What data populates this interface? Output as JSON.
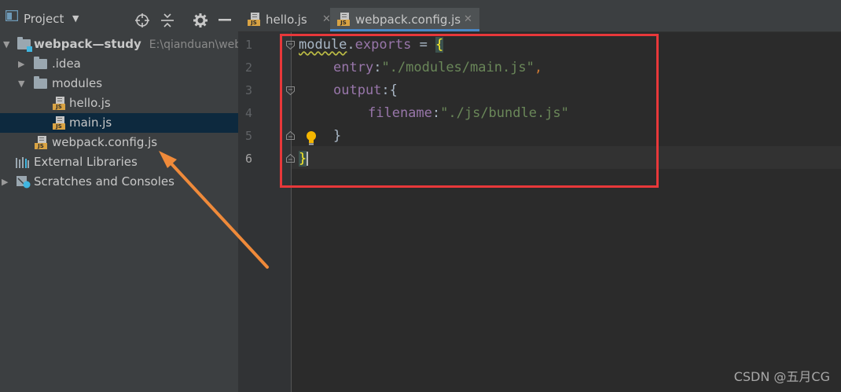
{
  "sidebar": {
    "title": "Project",
    "tree": [
      {
        "label": "webpack—study",
        "path": "E:\\qianduan\\webpack—study",
        "type": "module",
        "expanded": true
      },
      {
        "label": ".idea",
        "type": "folder",
        "expanded": false
      },
      {
        "label": "modules",
        "type": "folder",
        "expanded": true
      },
      {
        "label": "hello.js",
        "type": "js"
      },
      {
        "label": "main.js",
        "type": "js",
        "selected": true
      },
      {
        "label": "webpack.config.js",
        "type": "js"
      },
      {
        "label": "External Libraries",
        "type": "libraries"
      },
      {
        "label": "Scratches and Consoles",
        "type": "scratches",
        "expanded": false
      }
    ],
    "js_badge": "JS"
  },
  "tabs": [
    {
      "label": "hello.js",
      "active": false
    },
    {
      "label": "webpack.config.js",
      "active": true
    }
  ],
  "editor": {
    "line_numbers": [
      "1",
      "2",
      "3",
      "4",
      "5",
      "6"
    ],
    "current_line": 6,
    "code": {
      "l1_module": "module",
      "l1_dot": ".",
      "l1_exports": "exports",
      "l1_eq": " = ",
      "l1_brace": "{",
      "l2_key": "entry",
      "l2_colon": ":",
      "l2_value": "\"./modules/main.js\"",
      "l2_comma": ",",
      "l3_key": "output",
      "l3_colon": ":",
      "l3_brace": "{",
      "l4_key": "filename",
      "l4_colon": ":",
      "l4_value": "\"./js/bundle.js\"",
      "l5_brace": "}",
      "l6_brace": "}"
    }
  },
  "watermark": "CSDN @五月CG",
  "colors": {
    "annotation_box": "#e8383a",
    "arrow": "#ef8a3a",
    "tab_accent": "#4a88c7"
  }
}
